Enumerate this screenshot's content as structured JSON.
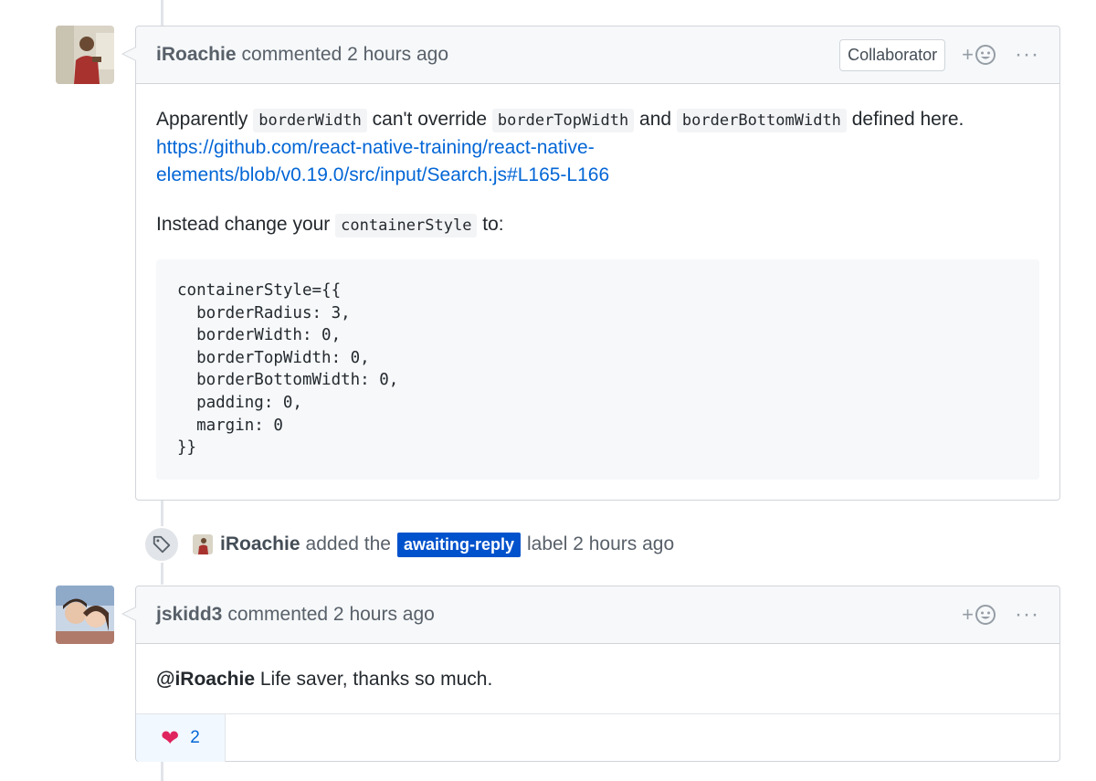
{
  "comment1": {
    "author": "iRoachie",
    "meta": "commented 2 hours ago",
    "badge": "Collaborator",
    "react_plus": "+",
    "more": "···",
    "body": {
      "p1_a": "Apparently ",
      "code_a": "borderWidth",
      "p1_b": " can't override ",
      "code_b": "borderTopWidth",
      "p1_c": " and ",
      "code_c": "borderBottomWidth",
      "p1_d": " defined here.",
      "link_line1": "https://github.com/react-native-training/react-native-",
      "link_line2": "elements/blob/v0.19.0/src/input/Search.js#L165-L166",
      "p2_a": "Instead change your ",
      "code_d": "containerStyle",
      "p2_b": " to:",
      "code_block": "containerStyle={{\n  borderRadius: 3,\n  borderWidth: 0,\n  borderTopWidth: 0,\n  borderBottomWidth: 0,\n  padding: 0,\n  margin: 0\n}}"
    }
  },
  "event": {
    "author": "iRoachie",
    "action": "added the",
    "label": "awaiting-reply",
    "suffix": "label 2 hours ago",
    "label_color": "#0052cc"
  },
  "comment2": {
    "author": "jskidd3",
    "meta": "commented 2 hours ago",
    "react_plus": "+",
    "more": "···",
    "mention": "@iRoachie",
    "text": " Life saver, thanks so much.",
    "reaction_emoji": "❤",
    "reaction_count": "2"
  }
}
